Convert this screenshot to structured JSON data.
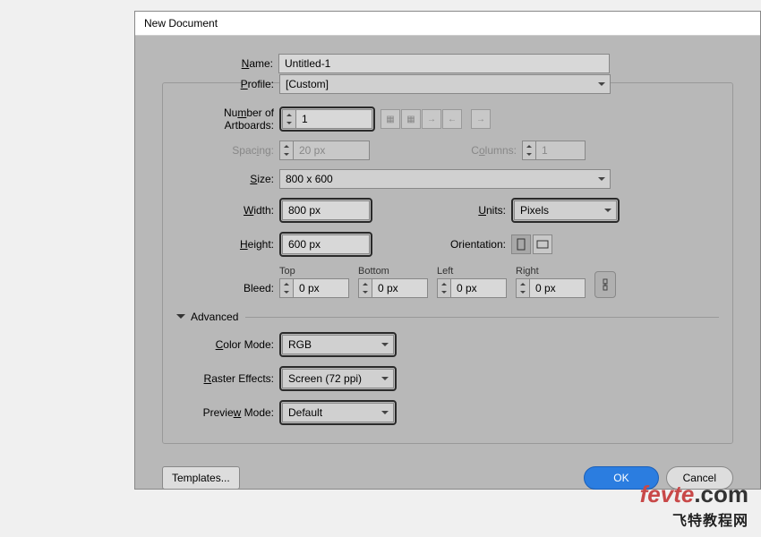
{
  "dialog": {
    "title": "New Document"
  },
  "name": {
    "label": "Name:",
    "value": "Untitled-1"
  },
  "profile": {
    "label": "Profile:",
    "value": "[Custom]"
  },
  "artboards": {
    "label": "Number of Artboards:",
    "value": "1"
  },
  "spacing": {
    "label": "Spacing:",
    "value": "20 px"
  },
  "columns": {
    "label": "Columns:",
    "value": "1"
  },
  "size": {
    "label": "Size:",
    "value": "800 x 600"
  },
  "width": {
    "label": "Width:",
    "value": "800 px"
  },
  "units": {
    "label": "Units:",
    "value": "Pixels"
  },
  "height": {
    "label": "Height:",
    "value": "600 px"
  },
  "orientation": {
    "label": "Orientation:"
  },
  "bleed": {
    "label": "Bleed:",
    "top": {
      "label": "Top",
      "value": "0 px"
    },
    "bottom": {
      "label": "Bottom",
      "value": "0 px"
    },
    "left": {
      "label": "Left",
      "value": "0 px"
    },
    "right": {
      "label": "Right",
      "value": "0 px"
    }
  },
  "advanced": {
    "label": "Advanced"
  },
  "colorMode": {
    "label": "Color Mode:",
    "value": "RGB"
  },
  "raster": {
    "label": "Raster Effects:",
    "value": "Screen (72 ppi)"
  },
  "preview": {
    "label": "Preview Mode:",
    "value": "Default"
  },
  "buttons": {
    "templates": "Templates...",
    "ok": "OK",
    "cancel": "Cancel"
  },
  "watermark": {
    "line1a": "fevte",
    "line1b": ".com",
    "line2": "飞特教程网"
  }
}
